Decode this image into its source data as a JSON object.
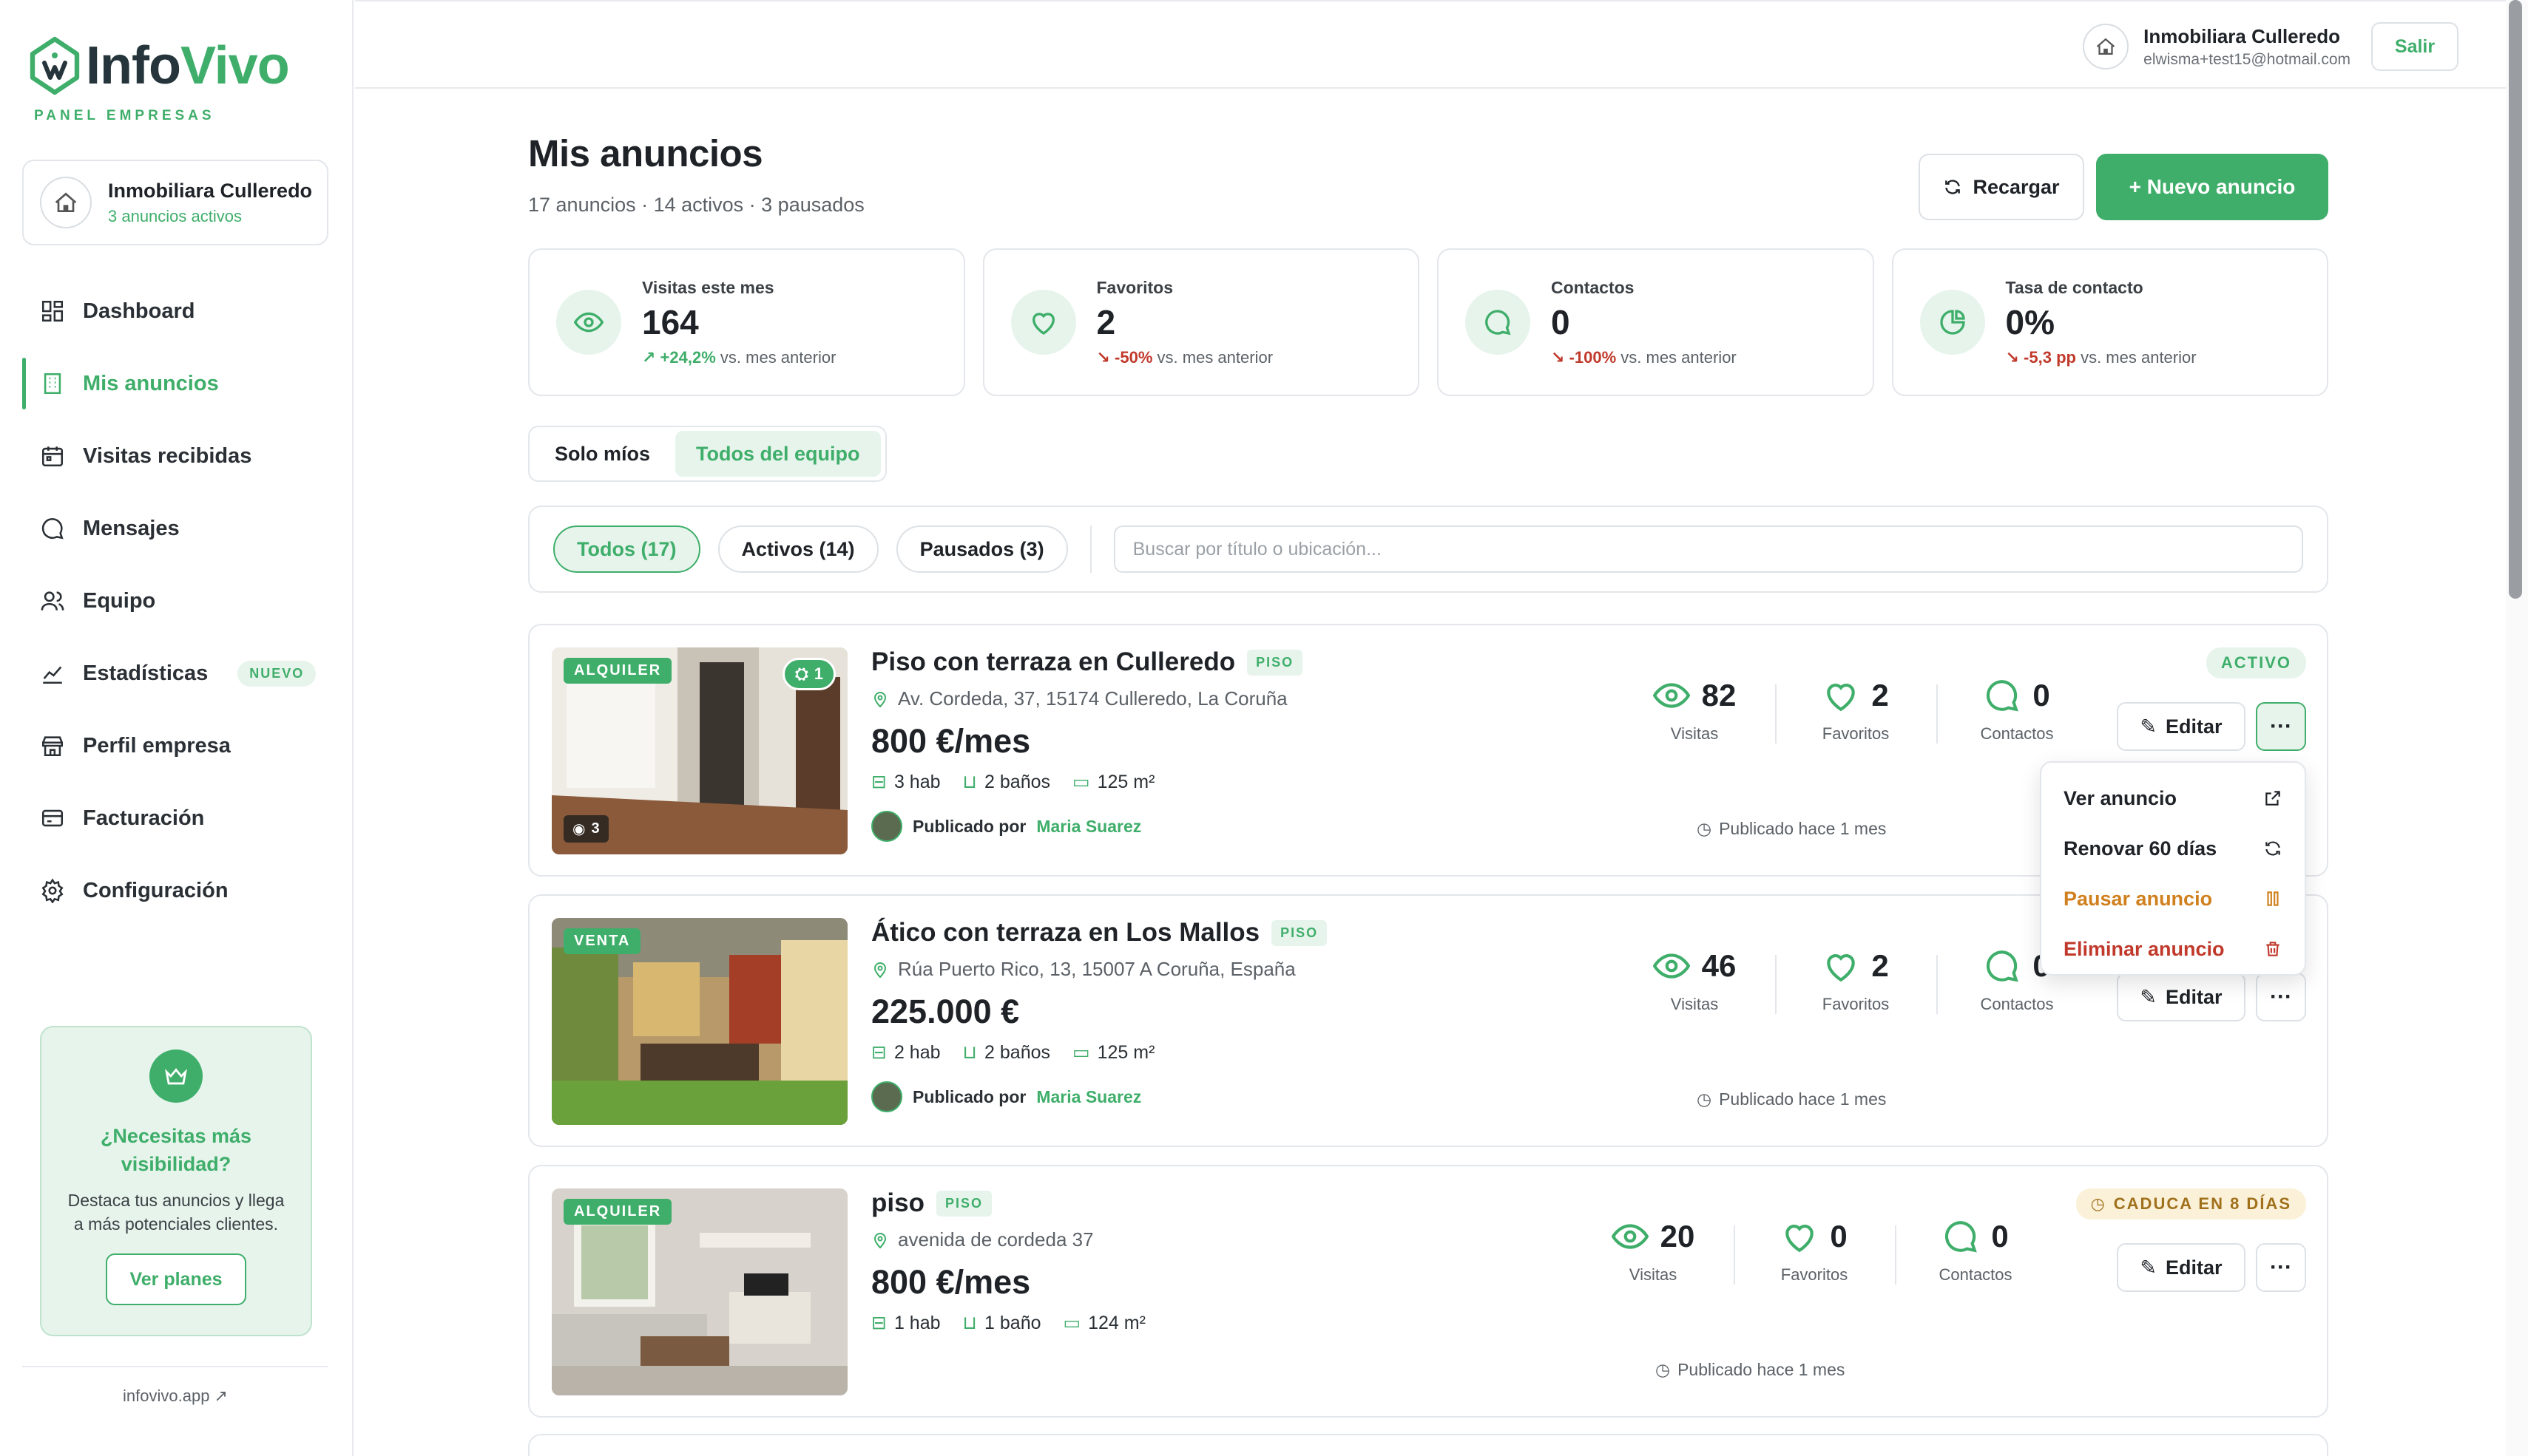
{
  "brand": {
    "logo_prefix": "Info",
    "logo_accent": "Vivo",
    "panel_label": "PANEL EMPRESAS",
    "accent_color": "#3fae6a"
  },
  "company": {
    "name": "Inmobiliara Culleredo",
    "active_listings": "3 anuncios activos"
  },
  "sidebar": {
    "items": [
      {
        "label": "Dashboard",
        "icon": "dashboard-icon"
      },
      {
        "label": "Mis anuncios",
        "icon": "building-icon",
        "active": true
      },
      {
        "label": "Visitas recibidas",
        "icon": "calendar-icon"
      },
      {
        "label": "Mensajes",
        "icon": "message-icon"
      },
      {
        "label": "Equipo",
        "icon": "team-icon"
      },
      {
        "label": "Estadísticas",
        "icon": "chart-icon",
        "badge": "NUEVO"
      },
      {
        "label": "Perfil empresa",
        "icon": "store-icon"
      },
      {
        "label": "Facturación",
        "icon": "card-icon"
      },
      {
        "label": "Configuración",
        "icon": "gear-icon"
      }
    ],
    "promo": {
      "title": "¿Necesitas más visibilidad?",
      "text": "Destaca tus anuncios y llega a más potenciales clientes.",
      "button": "Ver planes"
    },
    "footer_link": "infovivo.app ↗"
  },
  "topbar": {
    "user_name": "Inmobiliara Culleredo",
    "user_email": "elwisma+test15@hotmail.com",
    "logout": "Salir"
  },
  "header": {
    "title": "Mis anuncios",
    "subtitle": "17 anuncios · 14 activos · 3 pausados",
    "reload": "Recargar",
    "new_listing": "+ Nuevo anuncio"
  },
  "stats": [
    {
      "label": "Visitas este mes",
      "value": "164",
      "delta": "↗ +24,2%",
      "delta_dir": "up",
      "suffix": "vs. mes anterior",
      "icon": "eye-icon"
    },
    {
      "label": "Favoritos",
      "value": "2",
      "delta": "↘ -50%",
      "delta_dir": "down",
      "suffix": "vs. mes anterior",
      "icon": "heart-icon"
    },
    {
      "label": "Contactos",
      "value": "0",
      "delta": "↘ -100%",
      "delta_dir": "down",
      "suffix": "vs. mes anterior",
      "icon": "chat-icon"
    },
    {
      "label": "Tasa de contacto",
      "value": "0%",
      "delta": "↘ -5,3 pp",
      "delta_dir": "down",
      "suffix": "vs. mes anterior",
      "icon": "pie-icon"
    }
  ],
  "scope": {
    "mine": "Solo míos",
    "team": "Todos del equipo",
    "selected": "team"
  },
  "filters": {
    "all": "Todos (17)",
    "active": "Activos (14)",
    "paused": "Pausados (3)",
    "selected": "all",
    "search_placeholder": "Buscar por título o ubicación..."
  },
  "listings": [
    {
      "operation": "ALQUILER",
      "photo_count": "3",
      "visibility_count": "1",
      "title": "Piso con terraza en Culleredo",
      "type": "PISO",
      "address": "Av. Cordeda, 37, 15174 Culleredo, La Coruña",
      "price": "800 €/mes",
      "rooms": "3 hab",
      "baths": "2 baños",
      "area": "125 m²",
      "published_by_label": "Publicado por",
      "published_by": "Maria Suarez",
      "visits": "82",
      "favorites": "2",
      "contacts": "0",
      "visits_label": "Visitas",
      "favorites_label": "Favoritos",
      "contacts_label": "Contactos",
      "published_ago": "Publicado hace 1 mes",
      "status": "ACTIVO",
      "edit": "Editar"
    },
    {
      "operation": "VENTA",
      "title": "Ático con terraza en Los Mallos",
      "type": "PISO",
      "address": "Rúa Puerto Rico, 13, 15007 A Coruña, España",
      "price": "225.000 €",
      "rooms": "2 hab",
      "baths": "2 baños",
      "area": "125 m²",
      "published_by_label": "Publicado por",
      "published_by": "Maria Suarez",
      "visits": "46",
      "favorites": "2",
      "contacts": "0",
      "visits_label": "Visitas",
      "favorites_label": "Favoritos",
      "contacts_label": "Contactos",
      "published_ago": "Publicado hace 1 mes",
      "edit": "Editar"
    },
    {
      "operation": "ALQUILER",
      "title": "piso",
      "type": "PISO",
      "address": "avenida de cordeda 37",
      "price": "800 €/mes",
      "rooms": "1 hab",
      "baths": "1 baño",
      "area": "124 m²",
      "visits": "20",
      "favorites": "0",
      "contacts": "0",
      "visits_label": "Visitas",
      "favorites_label": "Favoritos",
      "contacts_label": "Contactos",
      "published_ago": "Publicado hace 1 mes",
      "status": "CADUCA EN 8 DÍAS",
      "edit": "Editar"
    }
  ],
  "actions_menu": {
    "view": "Ver anuncio",
    "renew": "Renovar 60 días",
    "pause": "Pausar anuncio",
    "delete": "Eliminar anuncio"
  }
}
